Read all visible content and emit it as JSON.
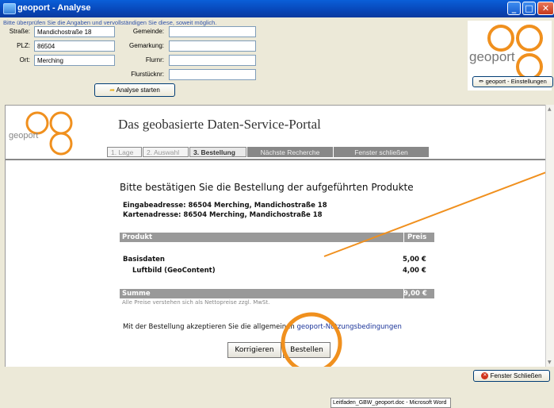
{
  "window": {
    "title": "geoport - Analyse"
  },
  "form": {
    "hint": "Bitte überprüfen Sie die Angaben und vervollständigen Sie diese, soweit möglich.",
    "strasse_label": "Straße:",
    "strasse_value": "Mandichostraße 18",
    "plz_label": "PLZ:",
    "plz_value": "86504",
    "ort_label": "Ort:",
    "ort_value": "Merching",
    "gemeinde_label": "Gemeinde:",
    "gemarkung_label": "Gemarkung:",
    "flurnr_label": "Flurnr:",
    "flurstuecknr_label": "Flurstücknr:",
    "analyse_button": "Analyse starten"
  },
  "logo": {
    "text": "geoport"
  },
  "settings_button": "geoport - Einstellungen",
  "portal": {
    "title": "Das geobasierte Daten-Service-Portal",
    "steps": [
      "1. Lage",
      "2. Auswahl",
      "3. Bestellung",
      "Nächste Recherche",
      "Fenster schließen"
    ],
    "headline": "Bitte bestätigen Sie die Bestellung der aufgeführten Produkte",
    "eingabe": "Eingabeadresse: 86504 Merching, Mandichostraße 18",
    "karten": "Kartenadresse: 86504 Merching, Mandichostraße 18",
    "col_produkt": "Produkt",
    "col_preis": "Preis",
    "items": [
      {
        "name": "Basisdaten",
        "price": "5,00 €"
      },
      {
        "name": "Luftbild (GeoContent)",
        "price": "4,00 €"
      }
    ],
    "sum_label": "Summe",
    "sum_value": "9,00 €",
    "note": "Alle Preise verstehen sich als Nettopreise zzgl. MwSt.",
    "terms_text": "Mit der Bestellung akzeptieren Sie die allgemeinen",
    "terms_link": "geoport-Nutzungsbedingungen",
    "korrigieren": "Korrigieren",
    "bestellen": "Bestellen"
  },
  "close_button": "Fenster Schließen",
  "taskbar_item": "Leitfaden_GBW_geoport.doc - Microsoft Word",
  "colors": {
    "accent_orange": "#f0901e",
    "title_blue": "#0a5fd8"
  }
}
